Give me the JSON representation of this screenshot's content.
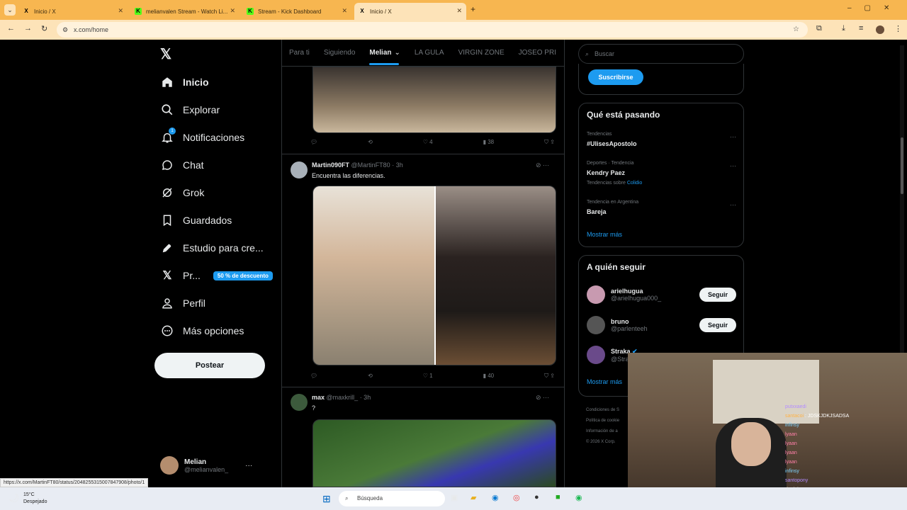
{
  "browser": {
    "tabs": [
      {
        "title": "Inicio / X",
        "favicon": "X"
      },
      {
        "title": "melianvalen Stream - Watch Li...",
        "favicon": "K"
      },
      {
        "title": "Stream - Kick Dashboard",
        "favicon": "K"
      },
      {
        "title": "Inicio / X",
        "favicon": "X"
      }
    ],
    "url": "x.com/home",
    "status_url": "https://x.com/MartinFT80/status/2048255315007847908/photo/1"
  },
  "leftnav": {
    "items": [
      {
        "label": "Inicio",
        "icon": "home-icon"
      },
      {
        "label": "Explorar",
        "icon": "search-icon"
      },
      {
        "label": "Notificaciones",
        "icon": "bell-icon"
      },
      {
        "label": "Chat",
        "icon": "chat-icon"
      },
      {
        "label": "Grok",
        "icon": "grok-icon"
      },
      {
        "label": "Guardados",
        "icon": "bookmark-icon"
      },
      {
        "label": "Estudio para cre...",
        "icon": "rocket-icon"
      },
      {
        "label": "Pr...",
        "icon": "x-premium-icon"
      },
      {
        "label": "Perfil",
        "icon": "person-icon"
      },
      {
        "label": "Más opciones",
        "icon": "more-icon"
      }
    ],
    "premium_badge": "50 % de descuento",
    "post_button": "Postear",
    "profile_name": "Melian",
    "profile_handle": "@melianvalen_",
    "notif_count": "1"
  },
  "feed": {
    "tabs": [
      "Para ti",
      "Siguiendo",
      "Melian",
      "LA GULA",
      "VIRGIN ZONE",
      "JOSEO PRI"
    ],
    "first_tweet_actions": {
      "likes": "4",
      "views": "38"
    },
    "tweets": [
      {
        "name": "Martin090FT",
        "handle": "@MartinFT80",
        "time": "· 3h",
        "text": "Encuentra las diferencias.",
        "likes": "1",
        "views": "40"
      },
      {
        "name": "max",
        "handle": "@maxkrill_",
        "time": "· 3h",
        "text": "?"
      }
    ]
  },
  "right": {
    "search_placeholder": "Buscar",
    "subscribe": "Suscribirse",
    "trending_title": "Qué está pasando",
    "trends": [
      {
        "context": "Tendencias",
        "name": "#UlisesApostolo"
      },
      {
        "context": "Deportes · Tendencia",
        "name": "Kendry Paez",
        "extra": "Tendencias sobre",
        "extra_link": "Colidio"
      },
      {
        "context": "Tendencia en Argentina",
        "name": "Bareja"
      }
    ],
    "show_more": "Mostrar más",
    "follow_title": "A quién seguir",
    "follows": [
      {
        "name": "arielhugua",
        "handle": "@arielhugua000_"
      },
      {
        "name": "bruno",
        "handle": "@parlenteeh"
      },
      {
        "name": "Straka",
        "handle": "@Stra"
      }
    ],
    "follow_label": "Seguir",
    "show_more2": "Mostrar más",
    "footer": [
      "Condiciones de S",
      "Política de cookie",
      "Información de a",
      "© 2026 X Corp."
    ]
  },
  "stream_chat": [
    {
      "user": "putxxaedi",
      "msg": ""
    },
    {
      "user": "santacoi",
      "msg": "JDSKJDKJSADSA"
    },
    {
      "user": "infinsy",
      "msg": ""
    },
    {
      "user": "lyaan",
      "msg": ""
    },
    {
      "user": "lyaan",
      "msg": ""
    },
    {
      "user": "lyaan",
      "msg": ""
    },
    {
      "user": "lyaan",
      "msg": ""
    },
    {
      "user": "infinsy",
      "msg": ""
    },
    {
      "user": "santopony",
      "msg": ""
    },
    {
      "user": "daniel0",
      "msg": ""
    },
    {
      "user": "daniel0",
      "msg": ""
    }
  ],
  "taskbar": {
    "temp": "15°C",
    "weather": "Despejado",
    "search": "Búsqueda"
  }
}
